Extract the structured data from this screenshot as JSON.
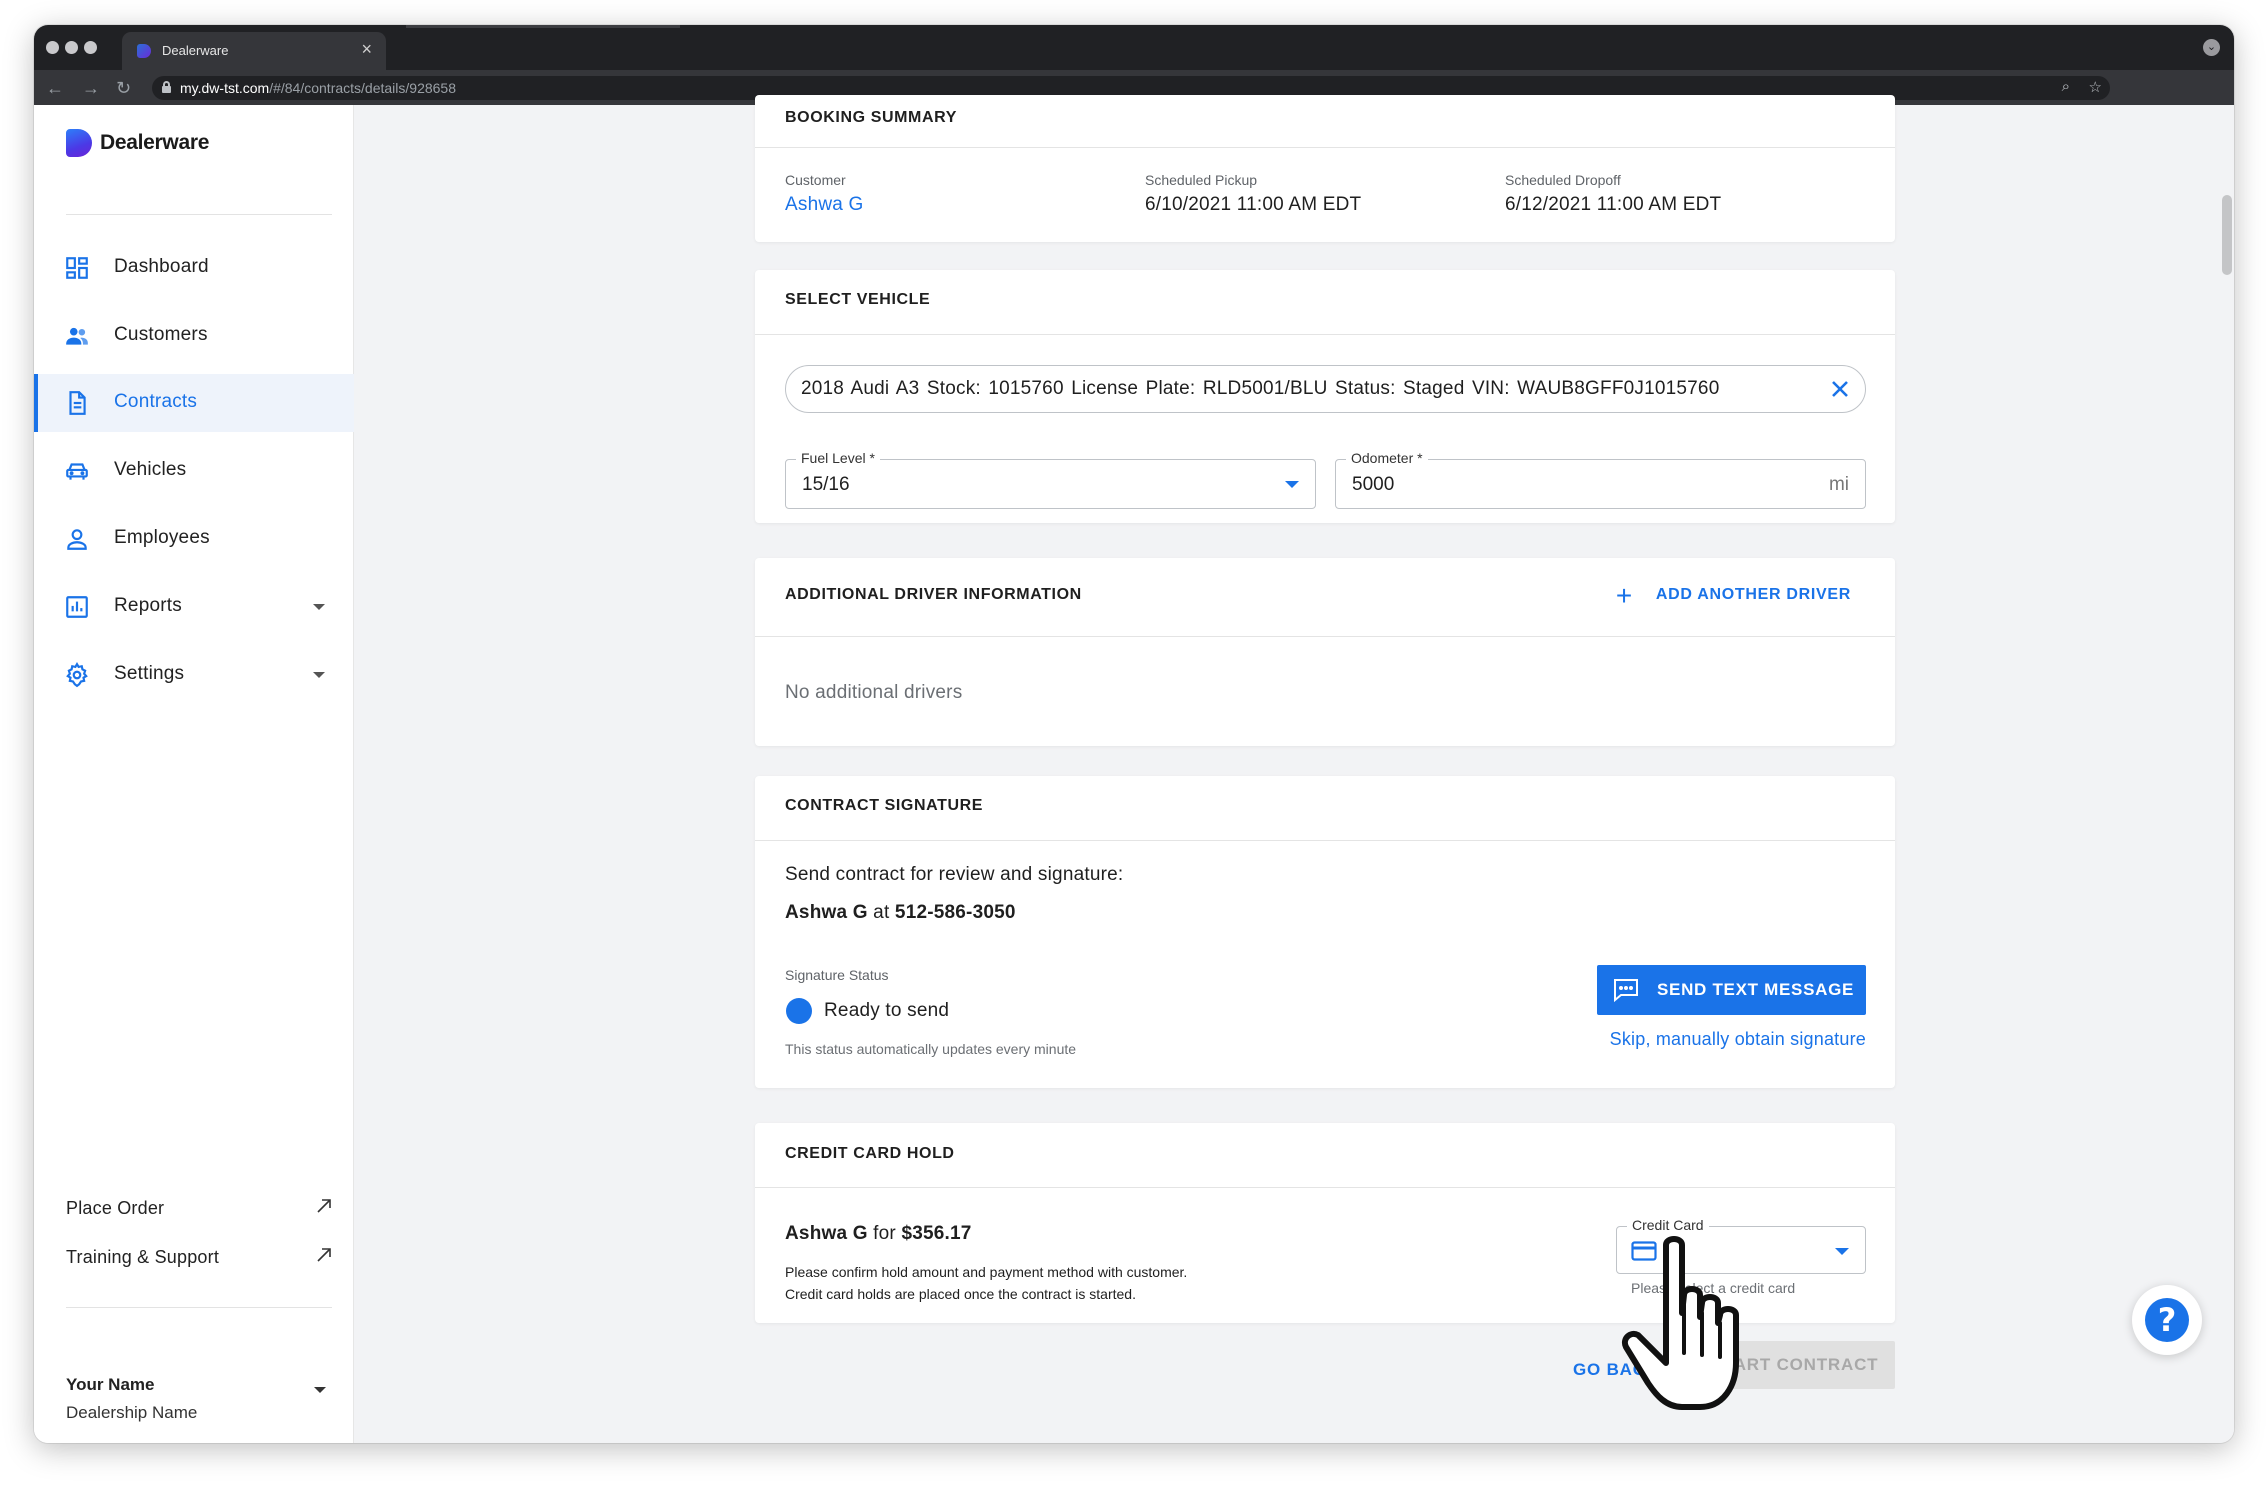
{
  "browser": {
    "tab_title": "Dealerware",
    "tab_close": "×",
    "url_host": "my.dw-tst.com",
    "url_path": "/#/84/contracts/details/928658",
    "nav_back": "←",
    "nav_forward": "→",
    "nav_reload": "↻",
    "zoom_icon_glyph": "⌕",
    "star_icon_glyph": "☆",
    "window_control_glyph": "⌄"
  },
  "sidebar": {
    "brand": "Dealerware",
    "items": [
      {
        "label": "Dashboard",
        "icon": "dashboard-icon"
      },
      {
        "label": "Customers",
        "icon": "customers-icon"
      },
      {
        "label": "Contracts",
        "icon": "contracts-icon",
        "active": true
      },
      {
        "label": "Vehicles",
        "icon": "vehicle-icon"
      },
      {
        "label": "Employees",
        "icon": "employee-icon"
      },
      {
        "label": "Reports",
        "icon": "reports-icon",
        "expandable": true
      },
      {
        "label": "Settings",
        "icon": "gear-icon",
        "expandable": true
      }
    ],
    "links": [
      {
        "label": "Place Order",
        "icon": "external-arrow-icon"
      },
      {
        "label": "Training & Support",
        "icon": "external-arrow-icon"
      }
    ],
    "user": {
      "name": "Your Name",
      "dealership": "Dealership Name"
    }
  },
  "booking_summary": {
    "title": "BOOKING SUMMARY",
    "customer_label": "Customer",
    "customer_value": "Ashwa G",
    "pickup_label": "Scheduled Pickup",
    "pickup_value": "6/10/2021 11:00 AM EDT",
    "dropoff_label": "Scheduled Dropoff",
    "dropoff_value": "6/12/2021 11:00 AM EDT"
  },
  "select_vehicle": {
    "title": "SELECT VEHICLE",
    "vehicle": "2018 Audi A3   Stock: 1015760   License Plate: RLD5001/BLU   Status: Staged   VIN: WAUB8GFF0J1015760",
    "fuel_label": "Fuel Level *",
    "fuel_value": "15/16",
    "odometer_label": "Odometer *",
    "odometer_value": "5000",
    "odometer_unit": "mi"
  },
  "additional_drivers": {
    "title": "ADDITIONAL DRIVER INFORMATION",
    "add_label": "ADD ANOTHER DRIVER",
    "add_glyph": "+",
    "empty_text": "No additional drivers"
  },
  "contract_signature": {
    "title": "CONTRACT SIGNATURE",
    "intro": "Send contract for review and signature:",
    "recipient_name": "Ashwa G",
    "recipient_at": " at ",
    "recipient_phone": "512-586-3050",
    "status_label": "Signature Status",
    "status_value": "Ready to send",
    "status_note": "This status automatically updates every minute",
    "send_button": "SEND TEXT MESSAGE",
    "skip_link": "Skip, manually obtain signature"
  },
  "credit_card_hold": {
    "title": "CREDIT CARD HOLD",
    "customer": "Ashwa G",
    "for_text": " for ",
    "amount": "$356.17",
    "note_line1": "Please confirm hold amount and payment method with customer.",
    "note_line2": "Credit card holds are placed once the contract is started.",
    "select_label": "Credit Card",
    "select_helper": "Please select a credit card"
  },
  "footer_actions": {
    "go_back": "GO BACK",
    "start": "START CONTRACT"
  },
  "help": {
    "glyph": "?"
  },
  "colors": {
    "accent": "#1a73e8",
    "page_bg": "#f2f3f5",
    "disabled_bg": "#e0e0e0"
  }
}
